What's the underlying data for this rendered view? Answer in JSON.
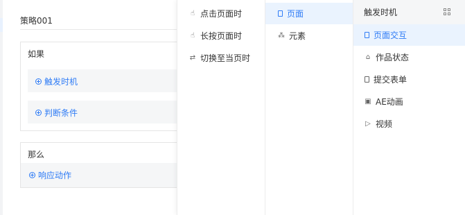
{
  "editor": {
    "strategy_name": "策略001",
    "if_section": {
      "title": "如果",
      "trigger_label": "触发时机",
      "condition_label": "判断条件"
    },
    "then_section": {
      "title": "那么",
      "action_label": "响应动作"
    }
  },
  "menu_level1": {
    "items": [
      {
        "label": "点击页面时",
        "icon": "tap-icon"
      },
      {
        "label": "长按页面时",
        "icon": "long-press-icon"
      },
      {
        "label": "切换至当页时",
        "icon": "switch-arrows-icon"
      }
    ]
  },
  "menu_level2": {
    "items": [
      {
        "label": "页面",
        "icon": "page-icon",
        "selected": true
      },
      {
        "label": "元素",
        "icon": "element-tree-icon"
      }
    ]
  },
  "menu_level3": {
    "header": "触发时机",
    "items": [
      {
        "label": "页面交互",
        "icon": "page-icon",
        "selected": true
      },
      {
        "label": "作品状态",
        "icon": "tag-icon"
      },
      {
        "label": "提交表单",
        "icon": "form-icon"
      },
      {
        "label": "AE动画",
        "icon": "animation-icon"
      },
      {
        "label": "视频",
        "icon": "video-play-icon"
      }
    ]
  },
  "colors": {
    "accent": "#2f7cf6",
    "selected_bg": "#eaf3fe",
    "row_bg": "#f5f6f7"
  }
}
